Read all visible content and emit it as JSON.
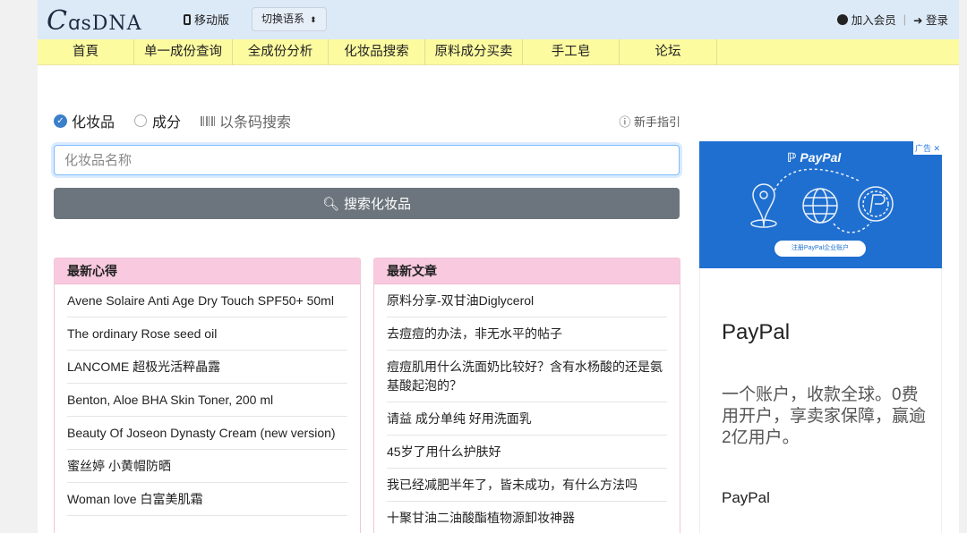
{
  "header": {
    "logo": "CosDNA",
    "mobile_label": "移动版",
    "language_label": "切换语系",
    "join_label": "加入会员",
    "login_label": "登录"
  },
  "nav": {
    "items": [
      "首頁",
      "单一成份查询",
      "全成份分析",
      "化妆品搜索",
      "原料成分买卖",
      "手工皂",
      "论坛"
    ]
  },
  "search": {
    "options": {
      "cosmetic": "化妆品",
      "ingredient": "成分",
      "barcode": "以条码搜索"
    },
    "selected": "化妆品",
    "guide_label": "新手指引",
    "placeholder": "化妆品名称",
    "value": "",
    "button_label": "搜索化妆品"
  },
  "latest_reviews": {
    "title": "最新心得",
    "items": [
      "Avene Solaire Anti Age Dry Touch SPF50+ 50ml",
      "The ordinary Rose seed oil",
      "LANCOME 超极光活粹晶露",
      "Benton, Aloe BHA Skin Toner, 200 ml",
      "Beauty Of Joseon Dynasty Cream (new version)",
      "蜜丝婷 小黄帽防晒",
      "Woman love 白富美肌霜"
    ]
  },
  "latest_articles": {
    "title": "最新文章",
    "items": [
      "原料分享-双甘油Diglycerol",
      "去痘痘的办法，非无水平的帖子",
      "痘痘肌用什么洗面奶比较好？含有水杨酸的还是氨基酸起泡的？",
      "请益 成分单纯 好用洗面乳",
      "45岁了用什么护肤好",
      "我已经减肥半年了，皆未成功，有什么方法吗",
      "十聚甘油二油酸酯植物源卸妆神器"
    ]
  },
  "ad": {
    "tag": "广告",
    "brand": "PayPal",
    "cta": "注册PayPal企业账户",
    "title": "PayPal",
    "description": "一个账户，收款全球。0费用开户，享卖家保障，赢逾2亿用户。",
    "subtitle": "PayPal"
  },
  "colors": {
    "nav_bg": "#fdfba0",
    "topbar_bg": "#dce9f7",
    "card_header_bg": "#f8c9df",
    "accent": "#3b7eca",
    "button_bg": "#6c757d"
  }
}
